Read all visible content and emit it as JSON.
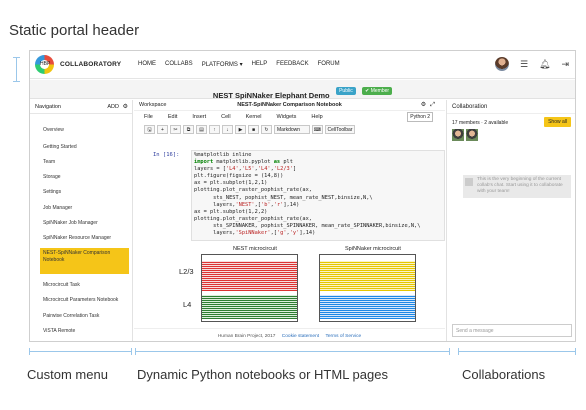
{
  "annotations": {
    "header": "Static portal header",
    "menu": "Custom menu",
    "notebooks": "Dynamic Python notebooks or HTML pages",
    "collab": "Collaborations"
  },
  "topnav": {
    "logo_letter": "HBP",
    "brand": "COLLABORATORY",
    "items": [
      "HOME",
      "COLLABS",
      "PLATFORMS ▾",
      "HELP",
      "FEEDBACK",
      "FORUM"
    ]
  },
  "title": {
    "text": "NEST SpiNNaker Elephant Demo",
    "public": "Public",
    "member": "✔ Member"
  },
  "sidebar": {
    "heading": "Navigation",
    "add": "ADD",
    "items": [
      {
        "label": "Overview"
      },
      {
        "label": "Getting Started"
      },
      {
        "label": "Team"
      },
      {
        "label": "Storage"
      },
      {
        "label": "Settings"
      },
      {
        "label": "Job Manager"
      },
      {
        "label": "SpiNNaker Job Manager"
      },
      {
        "label": "SpiNNaker Resource Manager"
      },
      {
        "label": "NEST-SpiNNaker Comparison Notebook"
      },
      {
        "label": "Microcircuit Task"
      },
      {
        "label": "Microcircuit Parameters Notebook"
      },
      {
        "label": "Pairwise Correlation Task"
      },
      {
        "label": "ViSTA Remote"
      }
    ],
    "active_index": 8
  },
  "workspace": {
    "label": "Workspace",
    "notebook_title": "NEST-SpiNNaker Comparison Notebook",
    "menu": [
      "File",
      "Edit",
      "Insert",
      "Cell",
      "Kernel",
      "Widgets",
      "Help"
    ],
    "kernel": "Python 2",
    "cell_type": "Markdown",
    "cell_toolbar": "CellToolbar",
    "prompt": "In [16]:",
    "plot_titles": [
      "NEST microcircuit",
      "SpiNNaker microcircuit"
    ],
    "y_labels": [
      "L2/3",
      "L4"
    ]
  },
  "footer": {
    "copyright": "Human Brain Project, 2017",
    "cookie": "Cookie statement",
    "terms": "Terms of Service"
  },
  "collab": {
    "heading": "Collaboration",
    "members": "17 members · 2 available",
    "show_all": "Show all",
    "bubble": "This is the very beginning of the current collab's chat. Start using it to collaborate with your team!",
    "placeholder": "Send a message"
  },
  "colors": {
    "accent": "#f5c518",
    "nest_l23": "#d33",
    "nest_l4": "#2e7d32",
    "spinn_l23": "#e6c700",
    "spinn_l4": "#1e88e5"
  }
}
